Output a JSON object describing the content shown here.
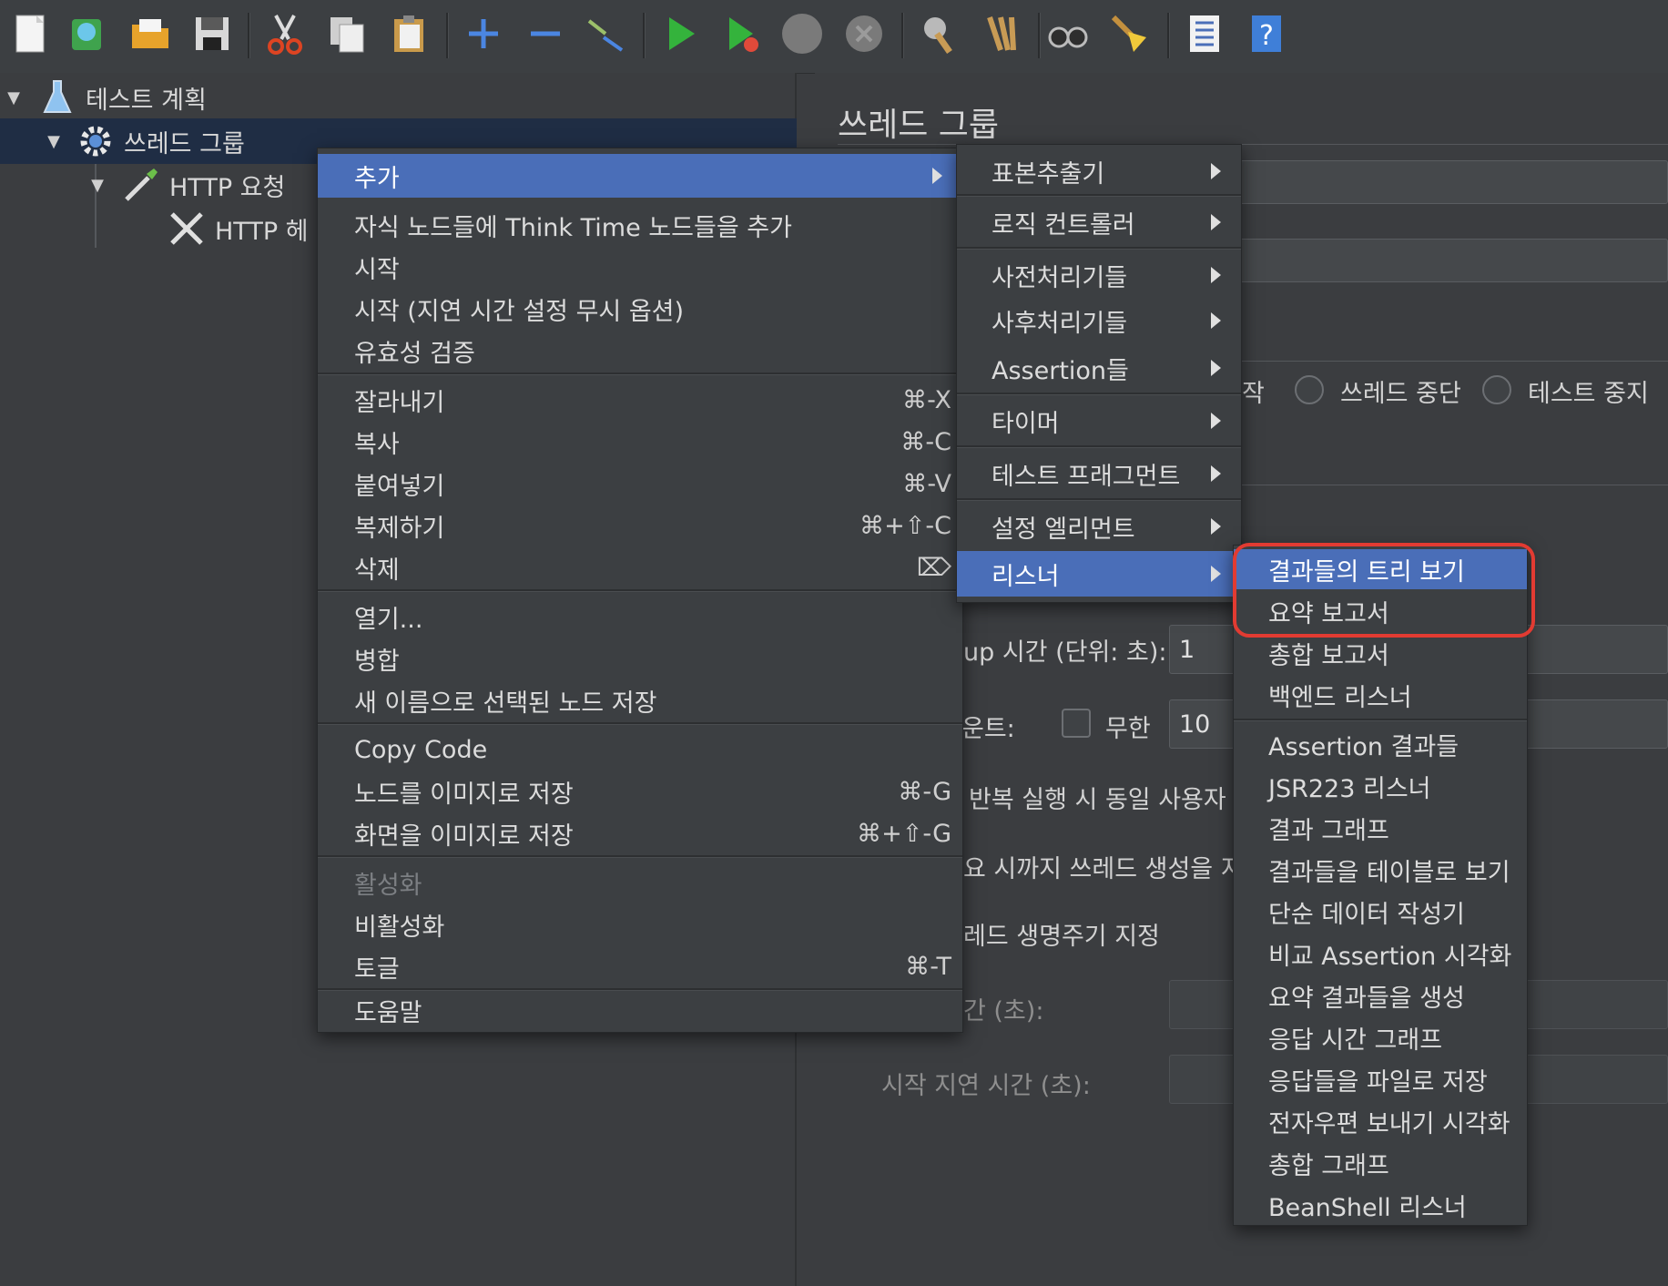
{
  "tree": {
    "test_plan": "테스트 계획",
    "thread_group": "쓰레드 그룹",
    "http_request": "HTTP 요청",
    "http_header": "HTTP 헤"
  },
  "panel": {
    "title": "쓰레드 그룹",
    "action_partial": "작",
    "stop_thread": "쓰레드 중단",
    "stop_test": "테스트 중지",
    "rampup_label": "up 시간 (단위: 초):",
    "rampup_value": "1",
    "loop_label": "운트:",
    "infinite": "무한",
    "loop_value": "10",
    "same_user": "반복 실행 시 동일 사용자",
    "delay_thread": "요 시까지 쓰레드 생성을 지",
    "lifetime": "레드 생명주기 지정",
    "duration": "간 (초):",
    "startup_delay": "시작 지연 시간 (초):"
  },
  "context_menu": {
    "add": "추가",
    "add_think_time": "자식 노드들에 Think Time 노드들을 추가",
    "start": "시작",
    "start_no_pause": "시작 (지연 시간 설정 무시 옵션)",
    "validate": "유효성 검증",
    "cut": "잘라내기",
    "cut_sc": "⌘-X",
    "copy": "복사",
    "copy_sc": "⌘-C",
    "paste": "붙여넣기",
    "paste_sc": "⌘-V",
    "duplicate": "복제하기",
    "duplicate_sc": "⌘+⇧-C",
    "remove": "삭제",
    "remove_sc": "⌦",
    "open": "열기...",
    "merge": "병합",
    "save_as": "새 이름으로 선택된 노드 저장",
    "copy_code": "Copy Code",
    "save_node_image": "노드를 이미지로 저장",
    "save_node_image_sc": "⌘-G",
    "save_screen_image": "화면을 이미지로 저장",
    "save_screen_image_sc": "⌘+⇧-G",
    "enable": "활성화",
    "disable": "비활성화",
    "toggle": "토글",
    "toggle_sc": "⌘-T",
    "help": "도움말"
  },
  "add_submenu": {
    "sampler": "표본추출기",
    "logic_controller": "로직 컨트롤러",
    "pre_processors": "사전처리기들",
    "post_processors": "사후처리기들",
    "assertions": "Assertion들",
    "timer": "타이머",
    "test_fragment": "테스트 프래그먼트",
    "config_element": "설정 엘리먼트",
    "listener": "리스너"
  },
  "listener_submenu": {
    "items": [
      "결과들의 트리 보기",
      "요약 보고서",
      "총합 보고서",
      "백엔드 리스너",
      "Assertion 결과들",
      "JSR223 리스너",
      "결과 그래프",
      "결과들을 테이블로 보기",
      "단순 데이터 작성기",
      "비교 Assertion 시각화",
      "요약 결과들을 생성",
      "응답 시간 그래프",
      "응답들을 파일로 저장",
      "전자우편 보내기 시각화",
      "총합 그래프",
      "BeanShell 리스너"
    ]
  },
  "colors": {
    "highlight": "#4a6eb8",
    "annotation": "#e23b32",
    "background": "#3b3d40"
  }
}
